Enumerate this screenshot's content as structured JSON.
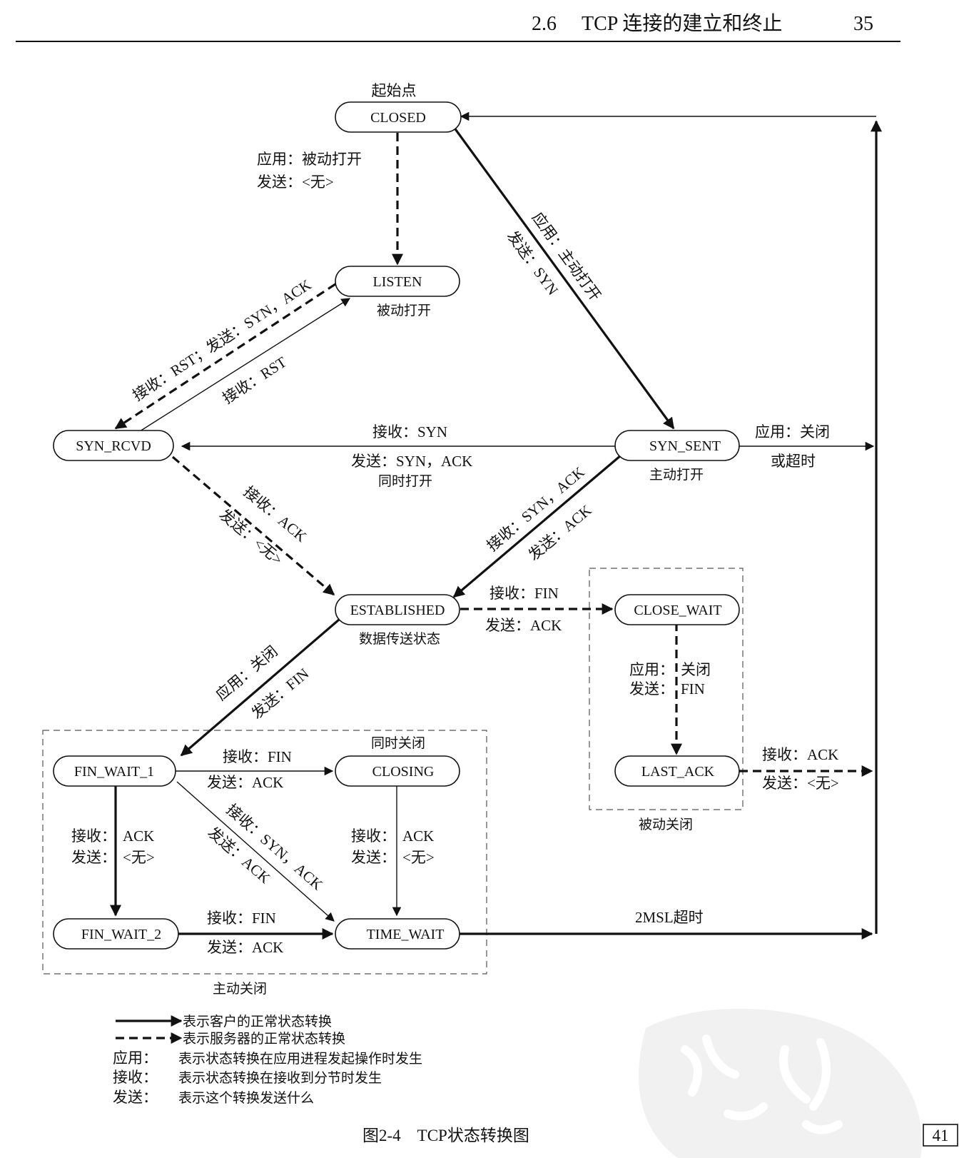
{
  "header": {
    "section": "2.6",
    "title": "TCP 连接的建立和终止",
    "page": "35"
  },
  "caption": "图2-4　TCP状态转换图",
  "corner_page": "41",
  "start_label": "起始点",
  "states": {
    "closed": "CLOSED",
    "listen": "LISTEN",
    "syn_rcvd": "SYN_RCVD",
    "syn_sent": "SYN_SENT",
    "established": "ESTABLISHED",
    "close_wait": "CLOSE_WAIT",
    "last_ack": "LAST_ACK",
    "fin_wait_1": "FIN_WAIT_1",
    "fin_wait_2": "FIN_WAIT_2",
    "closing": "CLOSING",
    "time_wait": "TIME_WAIT"
  },
  "state_notes": {
    "listen": "被动打开",
    "syn_sent": "主动打开",
    "established": "数据传送状态",
    "closing": "同时关闭"
  },
  "groups": {
    "passive_close": "被动关闭",
    "active_close": "主动关闭"
  },
  "transitions": {
    "closed_listen_1": "应用：被动打开",
    "closed_listen_2": "发送：<无>",
    "closed_synsent_1": "应用：主动打开",
    "closed_synsent_2": "发送：SYN",
    "listen_synrcvd": "接收：RST；发送：SYN，ACK",
    "synrcvd_listen": "接收：RST",
    "synsent_synrcvd_1": "接收：SYN",
    "synsent_synrcvd_2": "发送：SYN，ACK",
    "synsent_synrcvd_3": "同时打开",
    "synsent_close_1": "应用：关闭",
    "synsent_close_2": "或超时",
    "synrcvd_est_1": "接收：ACK",
    "synrcvd_est_2": "发送：<无>",
    "synsent_est_1": "接收：SYN，ACK",
    "synsent_est_2": "发送：ACK",
    "est_closewait_1": "接收：FIN",
    "est_closewait_2": "发送：ACK",
    "closewait_lastack_1a": "应用：",
    "closewait_lastack_1b": "关闭",
    "closewait_lastack_2a": "发送：",
    "closewait_lastack_2b": "FIN",
    "lastack_closed_1": "接收：ACK",
    "lastack_closed_2": "发送：<无>",
    "est_finwait1_1": "应用：关闭",
    "est_finwait1_2": "发送：FIN",
    "fw1_closing_1": "接收：FIN",
    "fw1_closing_2": "发送：ACK",
    "fw1_fw2_1a": "接收：",
    "fw1_fw2_1b": "ACK",
    "fw1_fw2_2a": "发送：",
    "fw1_fw2_2b": "<无>",
    "closing_tw_1a": "接收：",
    "closing_tw_1b": "ACK",
    "closing_tw_2a": "发送：",
    "closing_tw_2b": "<无>",
    "fw1_tw_1": "接收：SYN，ACK",
    "fw1_tw_2": "发送：ACK",
    "fw2_tw_1": "接收：FIN",
    "fw2_tw_2": "发送：ACK",
    "tw_closed": "2MSL超时"
  },
  "legend": {
    "solid": "表示客户的正常状态转换",
    "dashed": "表示服务器的正常状态转换",
    "app_key": "应用：",
    "app_desc": "表示状态转换在应用进程发起操作时发生",
    "recv_key": "接收：",
    "recv_desc": "表示状态转换在接收到分节时发生",
    "send_key": "发送：",
    "send_desc": "表示这个转换发送什么"
  }
}
